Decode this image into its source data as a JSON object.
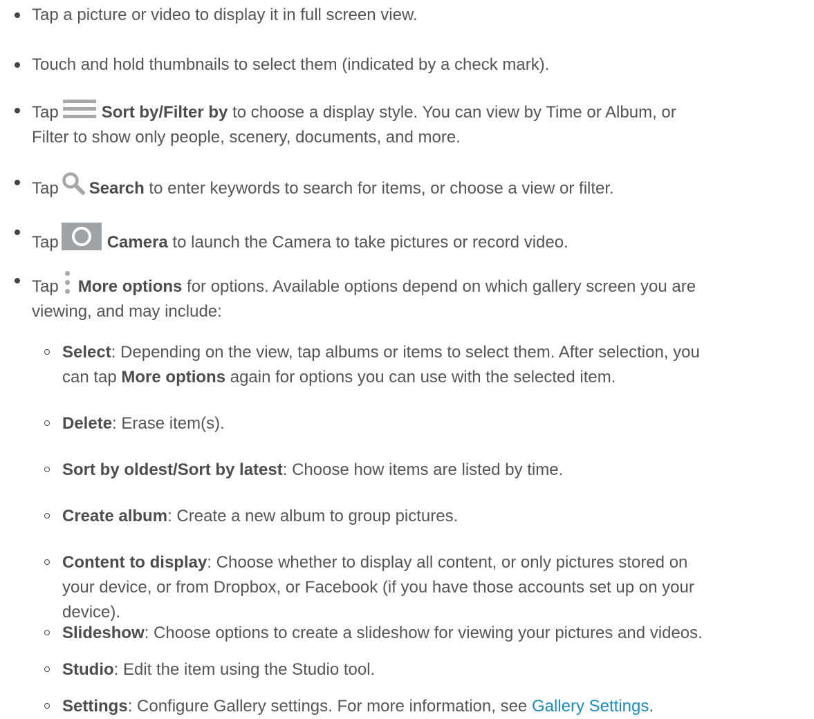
{
  "items": [
    {
      "text": "Tap a picture or video to display it in full screen view."
    },
    {
      "text": "Touch and hold thumbnails to select them (indicated by a check mark)."
    },
    {
      "pre": "Tap",
      "icon": "menu-icon",
      "bold": "Sort by/Filter by",
      "line1": " to choose a display style. You can view by Time or Album, or",
      "line2": "Filter to show only people, scenery, documents, and more."
    },
    {
      "pre": "Tap",
      "icon": "search-icon",
      "bold": "Search",
      "rest": " to enter keywords to search for items, or choose a view or filter."
    },
    {
      "pre": "Tap",
      "icon": "camera-icon",
      "bold": "Camera",
      "rest": " to launch the Camera to take pictures or record video."
    },
    {
      "pre": "Tap",
      "icon": "more-options-icon",
      "bold": "More options",
      "line1": " for options. Available options depend on which gallery screen you are",
      "line2": "viewing, and may include:"
    }
  ],
  "options": [
    {
      "label": "Select",
      "line1": ": Depending on the view, tap albums or items to select them. After selection, you",
      "line2_pre": "can tap ",
      "line2_bold": "More options",
      "line2_rest": " again for options you can use with the selected item."
    },
    {
      "label": "Delete",
      "desc": ": Erase item(s)."
    },
    {
      "label": "Sort by oldest/Sort by latest",
      "desc": ": Choose how items are listed by time."
    },
    {
      "label": "Create album",
      "desc": ": Create a new album to group pictures."
    },
    {
      "label": "Content to display",
      "line1": ": Choose whether to display all content, or only pictures stored on",
      "line2": "your device, or from Dropbox, or Facebook (if you have those accounts set up on your",
      "line3": "device)."
    },
    {
      "label": "Slideshow",
      "desc": ": Choose options to create a slideshow for viewing your pictures and videos."
    },
    {
      "label": "Studio",
      "desc": ": Edit the item using the Studio tool."
    },
    {
      "label": "Settings",
      "desc": ": Configure Gallery settings. For more information, see ",
      "link": "Gallery Settings",
      "end": "."
    }
  ],
  "colors": {
    "text": "#555555",
    "link": "#1b8cbf",
    "icon": "#a8a8a8"
  }
}
